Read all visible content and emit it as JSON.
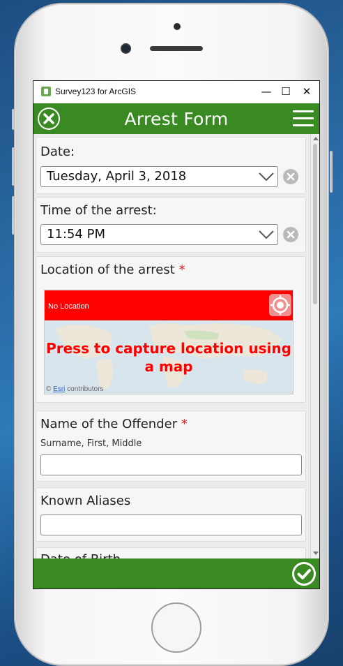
{
  "window": {
    "app_title": "Survey123 for ArcGIS",
    "minimize": "—",
    "maximize": "☐",
    "close": "✕"
  },
  "appbar": {
    "title": "Arrest Form"
  },
  "form": {
    "date": {
      "label": "Date:",
      "value": "Tuesday, April 3, 2018"
    },
    "time": {
      "label": "Time of the arrest:",
      "value": "11:54 PM"
    },
    "location": {
      "label": "Location of the arrest",
      "required_mark": "*",
      "status": "No Location",
      "prompt_line1": "Press to capture location using",
      "prompt_line2": "a map",
      "attribution_prefix": "©",
      "attribution_link": "Esri",
      "attribution_suffix": "contributors"
    },
    "offender_name": {
      "label": "Name of the Offender",
      "required_mark": "*",
      "hint": "Surname, First, Middle",
      "value": ""
    },
    "aliases": {
      "label": "Known Aliases",
      "value": ""
    },
    "dob": {
      "label": "Date of Birth"
    }
  },
  "icons": {
    "close": "close-icon",
    "menu": "hamburger-menu-icon",
    "dropdown": "chevron-down-icon",
    "clear": "clear-icon",
    "gps": "gps-locate-icon",
    "submit": "checkmark-icon"
  },
  "colors": {
    "header_green": "#3a8a23",
    "required_red": "#e02020",
    "map_banner_red": "#ff0000"
  }
}
